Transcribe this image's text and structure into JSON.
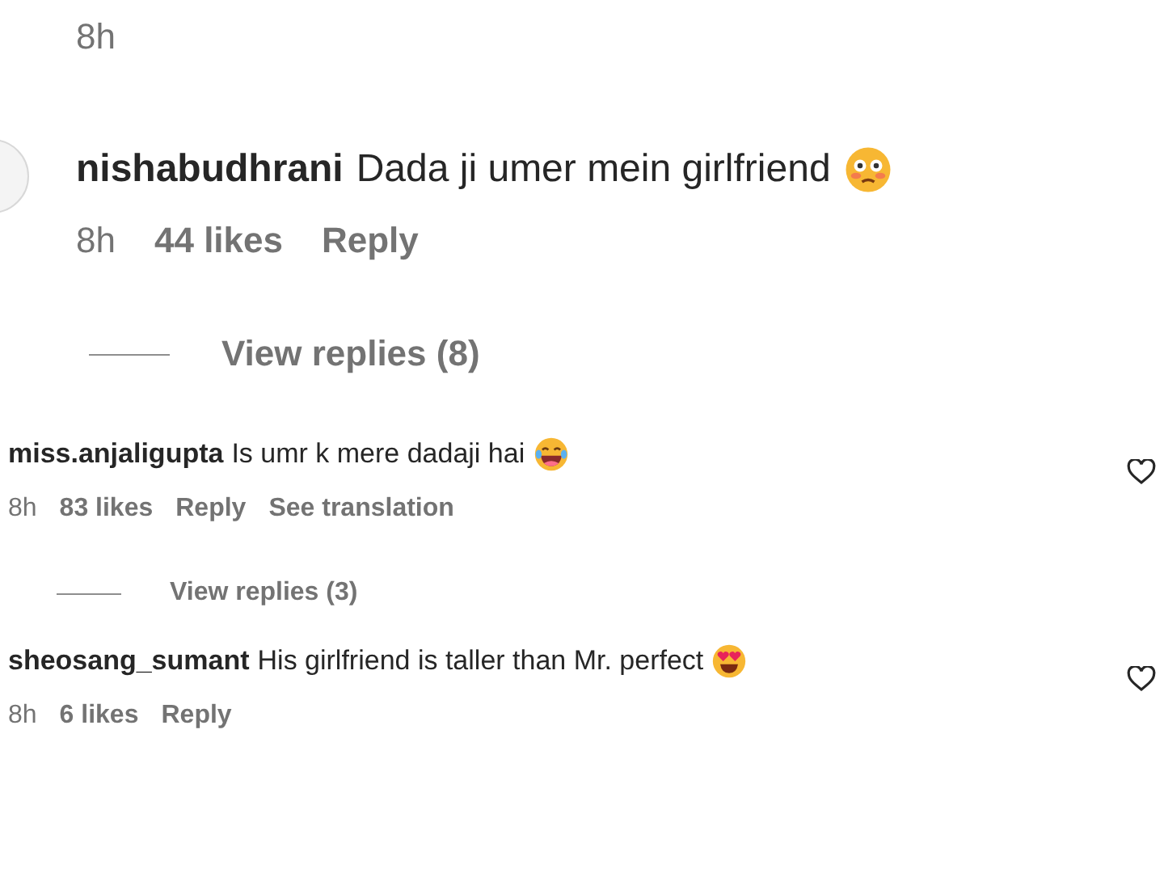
{
  "top_time": "8h",
  "comments": [
    {
      "kind": "large",
      "username": "nishabudhrani",
      "text": "Dada ji umer mein girlfriend",
      "time": "8h",
      "likes": "44 likes",
      "reply": "Reply",
      "view_replies": "View replies (8)"
    },
    {
      "kind": "compact",
      "username": "miss.anjaligupta",
      "text": "Is umr k mere dadaji hai",
      "time": "8h",
      "likes": "83 likes",
      "reply": "Reply",
      "see_translation": "See translation",
      "view_replies": "View replies (3)"
    },
    {
      "kind": "compact",
      "username": "sheosang_sumant",
      "text": "His girlfriend is taller than Mr. perfect",
      "time": "8h",
      "likes": "6 likes",
      "reply": "Reply"
    }
  ]
}
